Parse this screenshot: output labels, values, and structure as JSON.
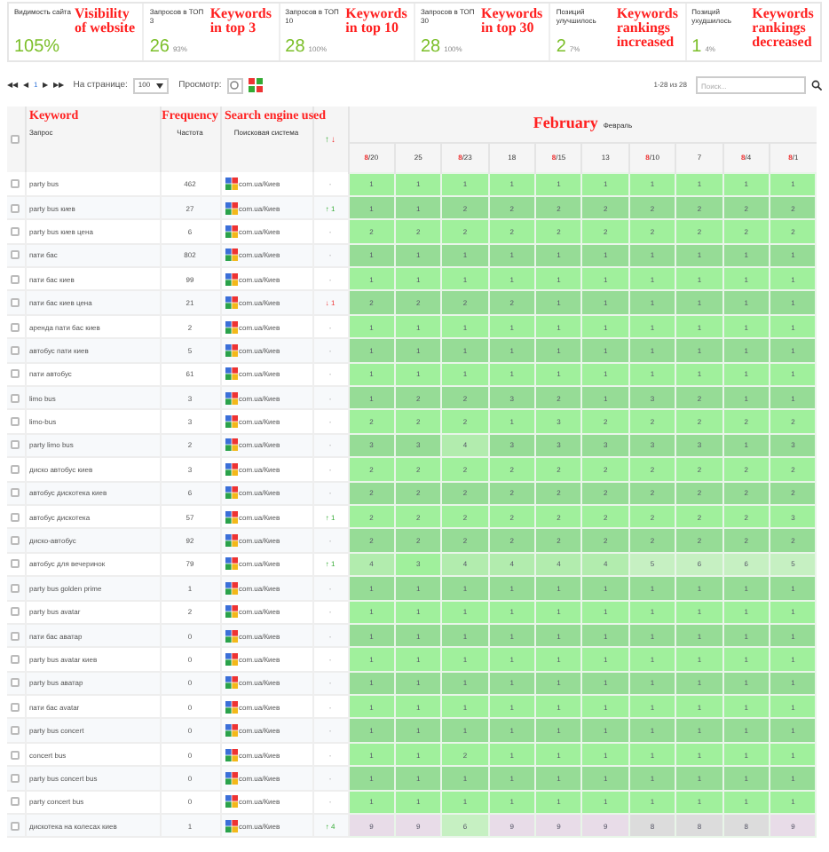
{
  "summary": [
    {
      "label": "Видимость сайта",
      "value": "105%",
      "annotation": "Visibility of website"
    },
    {
      "label": "Запросов в ТОП 3",
      "value": "26",
      "percent": "93%",
      "annotation": "Keywords in top 3"
    },
    {
      "label": "Запросов в ТОП 10",
      "value": "28",
      "percent": "100%",
      "annotation": "Keywords in top 10"
    },
    {
      "label": "Запросов в ТОП 30",
      "value": "28",
      "percent": "100%",
      "annotation": "Keywords in top 30"
    },
    {
      "label": "Позиций улучшилось",
      "value": "2",
      "percent": "7%",
      "annotation": "Keywords rankings increased"
    },
    {
      "label": "Позиций ухудшилось",
      "value": "1",
      "percent": "4%",
      "annotation": "Keywords rankings decreased"
    }
  ],
  "toolbar": {
    "pager": [
      "◀◀",
      "◀",
      "1",
      "▶",
      "▶▶"
    ],
    "per_page_label": "На странице:",
    "per_page": "100",
    "view_label": "Просмотр:",
    "range": "1-28 из 28",
    "search": {
      "placeholder": "Поиск..."
    }
  },
  "table": {
    "select_all": {
      "checked": false
    },
    "columns": [
      {
        "label": "Запрос",
        "annotation": "Keyword"
      },
      {
        "label": "Частота",
        "annotation": "Frequency"
      },
      {
        "label": "Поисковая система",
        "annotation": "Search engine used"
      },
      {
        "up": "↑",
        "down": "↓"
      }
    ],
    "month": {
      "label": "Февраль",
      "annotation": "February"
    },
    "dates": [
      {
        "prefix": "8",
        "day": "/20"
      },
      {
        "day": "25"
      },
      {
        "prefix": "8",
        "day": "/23"
      },
      {
        "day": "18"
      },
      {
        "prefix": "8",
        "day": "/15"
      },
      {
        "day": "13"
      },
      {
        "prefix": "8",
        "day": "/10"
      },
      {
        "day": "7"
      },
      {
        "prefix": "8",
        "day": "/4"
      },
      {
        "prefix": "8",
        "day": "/1"
      }
    ],
    "rows": [
      {
        "checked": false,
        "keyword": "party bus",
        "frequency": "462",
        "engine": "com.ua/Киев",
        "trend": {
          "kind": "none",
          "text": "-"
        },
        "positions": [
          "1",
          "1",
          "1",
          "1",
          "1",
          "1",
          "1",
          "1",
          "1",
          "1"
        ]
      },
      {
        "checked": false,
        "keyword": "party bus киев",
        "frequency": "27",
        "engine": "com.ua/Киев",
        "trend": {
          "kind": "up",
          "text": "↑ 1"
        },
        "positions": [
          "1",
          "1",
          "2",
          "2",
          "2",
          "2",
          "2",
          "2",
          "2",
          "2"
        ]
      },
      {
        "checked": false,
        "keyword": "party bus киев цена",
        "frequency": "6",
        "engine": "com.ua/Киев",
        "trend": {
          "kind": "none",
          "text": "-"
        },
        "positions": [
          "2",
          "2",
          "2",
          "2",
          "2",
          "2",
          "2",
          "2",
          "2",
          "2"
        ]
      },
      {
        "checked": false,
        "keyword": "пати бас",
        "frequency": "802",
        "engine": "com.ua/Киев",
        "trend": {
          "kind": "none",
          "text": "-"
        },
        "positions": [
          "1",
          "1",
          "1",
          "1",
          "1",
          "1",
          "1",
          "1",
          "1",
          "1"
        ]
      },
      {
        "checked": false,
        "keyword": "пати бас киев",
        "frequency": "99",
        "engine": "com.ua/Киев",
        "trend": {
          "kind": "none",
          "text": "-"
        },
        "positions": [
          "1",
          "1",
          "1",
          "1",
          "1",
          "1",
          "1",
          "1",
          "1",
          "1"
        ]
      },
      {
        "checked": false,
        "keyword": "пати бас киев цена",
        "frequency": "21",
        "engine": "com.ua/Киев",
        "trend": {
          "kind": "down",
          "text": "↓ 1"
        },
        "positions": [
          "2",
          "2",
          "2",
          "2",
          "1",
          "1",
          "1",
          "1",
          "1",
          "1"
        ]
      },
      {
        "checked": false,
        "keyword": "аренда пати бас киев",
        "frequency": "2",
        "engine": "com.ua/Киев",
        "trend": {
          "kind": "none",
          "text": "-"
        },
        "positions": [
          "1",
          "1",
          "1",
          "1",
          "1",
          "1",
          "1",
          "1",
          "1",
          "1"
        ]
      },
      {
        "checked": false,
        "keyword": "автобус пати киев",
        "frequency": "5",
        "engine": "com.ua/Киев",
        "trend": {
          "kind": "none",
          "text": "-"
        },
        "positions": [
          "1",
          "1",
          "1",
          "1",
          "1",
          "1",
          "1",
          "1",
          "1",
          "1"
        ]
      },
      {
        "checked": false,
        "keyword": "пати автобус",
        "frequency": "61",
        "engine": "com.ua/Киев",
        "trend": {
          "kind": "none",
          "text": "-"
        },
        "positions": [
          "1",
          "1",
          "1",
          "1",
          "1",
          "1",
          "1",
          "1",
          "1",
          "1"
        ]
      },
      {
        "checked": false,
        "keyword": "limo bus",
        "frequency": "3",
        "engine": "com.ua/Киев",
        "trend": {
          "kind": "none",
          "text": "-"
        },
        "positions": [
          "1",
          "2",
          "2",
          "3",
          "2",
          "1",
          "3",
          "2",
          "1",
          "1"
        ]
      },
      {
        "checked": false,
        "keyword": "limo-bus",
        "frequency": "3",
        "engine": "com.ua/Киев",
        "trend": {
          "kind": "none",
          "text": "-"
        },
        "positions": [
          "2",
          "2",
          "2",
          "1",
          "3",
          "2",
          "2",
          "2",
          "2",
          "2"
        ]
      },
      {
        "checked": false,
        "keyword": "party limo bus",
        "frequency": "2",
        "engine": "com.ua/Киев",
        "trend": {
          "kind": "none",
          "text": "-"
        },
        "positions": [
          "3",
          "3",
          "4",
          "3",
          "3",
          "3",
          "3",
          "3",
          "1",
          "3"
        ]
      },
      {
        "checked": false,
        "keyword": "диско автобус киев",
        "frequency": "3",
        "engine": "com.ua/Киев",
        "trend": {
          "kind": "none",
          "text": "-"
        },
        "positions": [
          "2",
          "2",
          "2",
          "2",
          "2",
          "2",
          "2",
          "2",
          "2",
          "2"
        ]
      },
      {
        "checked": false,
        "keyword": "автобус дискотека киев",
        "frequency": "6",
        "engine": "com.ua/Киев",
        "trend": {
          "kind": "none",
          "text": "-"
        },
        "positions": [
          "2",
          "2",
          "2",
          "2",
          "2",
          "2",
          "2",
          "2",
          "2",
          "2"
        ]
      },
      {
        "checked": false,
        "keyword": "автобус дискотека",
        "frequency": "57",
        "engine": "com.ua/Киев",
        "trend": {
          "kind": "up",
          "text": "↑ 1"
        },
        "positions": [
          "2",
          "2",
          "2",
          "2",
          "2",
          "2",
          "2",
          "2",
          "2",
          "3"
        ]
      },
      {
        "checked": false,
        "keyword": "диско-автобус",
        "frequency": "92",
        "engine": "com.ua/Киев",
        "trend": {
          "kind": "none",
          "text": "-"
        },
        "positions": [
          "2",
          "2",
          "2",
          "2",
          "2",
          "2",
          "2",
          "2",
          "2",
          "2"
        ]
      },
      {
        "checked": false,
        "keyword": "автобус для вечеринок",
        "frequency": "79",
        "engine": "com.ua/Киев",
        "trend": {
          "kind": "up",
          "text": "↑ 1"
        },
        "positions": [
          "4",
          "3",
          "4",
          "4",
          "4",
          "4",
          "5",
          "6",
          "6",
          "5"
        ]
      },
      {
        "checked": false,
        "keyword": "party bus golden prime",
        "frequency": "1",
        "engine": "com.ua/Киев",
        "trend": {
          "kind": "none",
          "text": "-"
        },
        "positions": [
          "1",
          "1",
          "1",
          "1",
          "1",
          "1",
          "1",
          "1",
          "1",
          "1"
        ]
      },
      {
        "checked": false,
        "keyword": "party bus avatar",
        "frequency": "2",
        "engine": "com.ua/Киев",
        "trend": {
          "kind": "none",
          "text": "-"
        },
        "positions": [
          "1",
          "1",
          "1",
          "1",
          "1",
          "1",
          "1",
          "1",
          "1",
          "1"
        ]
      },
      {
        "checked": false,
        "keyword": "пати бас аватар",
        "frequency": "0",
        "engine": "com.ua/Киев",
        "trend": {
          "kind": "none",
          "text": "-"
        },
        "positions": [
          "1",
          "1",
          "1",
          "1",
          "1",
          "1",
          "1",
          "1",
          "1",
          "1"
        ]
      },
      {
        "checked": false,
        "keyword": "party bus avatar киев",
        "frequency": "0",
        "engine": "com.ua/Киев",
        "trend": {
          "kind": "none",
          "text": "-"
        },
        "positions": [
          "1",
          "1",
          "1",
          "1",
          "1",
          "1",
          "1",
          "1",
          "1",
          "1"
        ]
      },
      {
        "checked": false,
        "keyword": "party bus аватар",
        "frequency": "0",
        "engine": "com.ua/Киев",
        "trend": {
          "kind": "none",
          "text": "-"
        },
        "positions": [
          "1",
          "1",
          "1",
          "1",
          "1",
          "1",
          "1",
          "1",
          "1",
          "1"
        ]
      },
      {
        "checked": false,
        "keyword": "пати бас avatar",
        "frequency": "0",
        "engine": "com.ua/Киев",
        "trend": {
          "kind": "none",
          "text": "-"
        },
        "positions": [
          "1",
          "1",
          "1",
          "1",
          "1",
          "1",
          "1",
          "1",
          "1",
          "1"
        ]
      },
      {
        "checked": false,
        "keyword": "party bus concert",
        "frequency": "0",
        "engine": "com.ua/Киев",
        "trend": {
          "kind": "none",
          "text": "-"
        },
        "positions": [
          "1",
          "1",
          "1",
          "1",
          "1",
          "1",
          "1",
          "1",
          "1",
          "1"
        ]
      },
      {
        "checked": false,
        "keyword": "concert bus",
        "frequency": "0",
        "engine": "com.ua/Киев",
        "trend": {
          "kind": "none",
          "text": "-"
        },
        "positions": [
          "1",
          "1",
          "2",
          "1",
          "1",
          "1",
          "1",
          "1",
          "1",
          "1"
        ]
      },
      {
        "checked": false,
        "keyword": "party bus concert bus",
        "frequency": "0",
        "engine": "com.ua/Киев",
        "trend": {
          "kind": "none",
          "text": "-"
        },
        "positions": [
          "1",
          "1",
          "1",
          "1",
          "1",
          "1",
          "1",
          "1",
          "1",
          "1"
        ]
      },
      {
        "checked": false,
        "keyword": "party concert bus",
        "frequency": "0",
        "engine": "com.ua/Киев",
        "trend": {
          "kind": "none",
          "text": "-"
        },
        "positions": [
          "1",
          "1",
          "1",
          "1",
          "1",
          "1",
          "1",
          "1",
          "1",
          "1"
        ]
      },
      {
        "checked": false,
        "keyword": "дискотека на колесах киев",
        "frequency": "1",
        "engine": "com.ua/Киев",
        "trend": {
          "kind": "up",
          "text": "↑ 4"
        },
        "positions": [
          "9",
          "9",
          "6",
          "9",
          "9",
          "9",
          "8",
          "8",
          "8",
          "9"
        ]
      }
    ]
  }
}
